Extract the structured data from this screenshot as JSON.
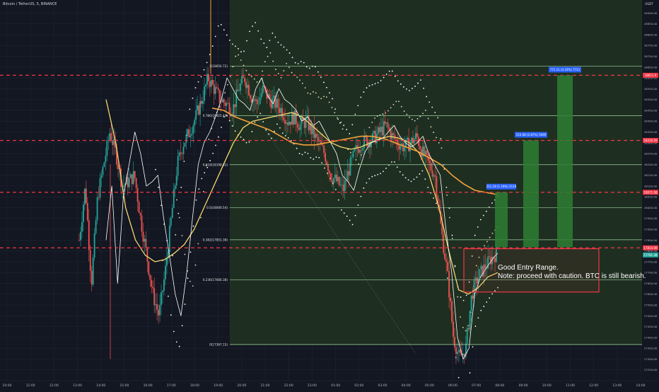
{
  "header": {
    "symbol": "Bitcoin / TetherUS, 5, BINANCE"
  },
  "note": {
    "line1": "Good Entry Range.",
    "line2": "Note: proceed with caution. BTC is still bearish."
  },
  "colors": {
    "background": "#131722",
    "highlight": "#1f3022",
    "grid": "#1e2433",
    "fib_line": "#9fd0a0",
    "red_level": "#f23645",
    "green_bar": "#2e7d32",
    "label_blue": "#2962ff",
    "up_candle": "#26a69a",
    "down_candle": "#ef5350",
    "ma_yellow": "#f5d76e",
    "ma_orange": "#f7a23b",
    "white_line": "#ffffff",
    "dotted_band": "#e8e0b0"
  },
  "chart_data": {
    "type": "candlestick",
    "symbol": "BTCUSDT",
    "timeframe": "5",
    "exchange": "BINANCE",
    "x_ticks": [
      "10:00",
      "11:00",
      "12:00",
      "13:00",
      "14:00",
      "15:00",
      "16:00",
      "17:00",
      "18:00",
      "19:00",
      "20:00",
      "21:00",
      "22:00",
      "23:00",
      "01:00",
      "02:00",
      "03:00",
      "04:00",
      "05:00",
      "06:00",
      "07:00",
      "08:00",
      "09:00",
      "10:00",
      "11:00",
      "12:00",
      "13:00",
      "14:00"
    ],
    "y_ticks": [
      "18900.00",
      "18850.00",
      "18800.00",
      "18750.00",
      "18700.00",
      "18650.00",
      "18600.00",
      "18550.00",
      "18500.00",
      "18450.00",
      "18400.00",
      "18350.00",
      "18300.00",
      "18250.00",
      "18200.00",
      "18150.00",
      "18100.00",
      "18050.00",
      "18000.00",
      "17950.00",
      "17900.00",
      "17850.00",
      "17800.00",
      "17750.00",
      "17700.00",
      "17650.00",
      "17600.00",
      "17550.00",
      "17500.00",
      "17450.00",
      "17400.00",
      "17350.00",
      "17300.00",
      "17250.00"
    ],
    "y_unit_label": "USDT",
    "ylim": [
      17200,
      18960
    ],
    "fib_levels": [
      {
        "ratio": 1,
        "label": "1(18654.72)",
        "price": 18654.72
      },
      {
        "ratio": 0.786,
        "label": "0.786(18425.44)",
        "price": 18425.44
      },
      {
        "ratio": 0.618,
        "label": "0.618(18198.51)",
        "price": 18198.51
      },
      {
        "ratio": 0.5,
        "label": "0.5(18000.54)",
        "price": 18000.54
      },
      {
        "ratio": 0.382,
        "label": "0.382(17851.38)",
        "price": 17851.38
      },
      {
        "ratio": 0.236,
        "label": "0.236(17666.38)",
        "price": 17666.38
      },
      {
        "ratio": 0,
        "label": "0(17367.15)",
        "price": 17367.15
      }
    ],
    "resistance_levels": [
      {
        "label": "18611.9",
        "price": 18611.9
      },
      {
        "label": "18310.59",
        "price": 18310.59
      },
      {
        "label": "18071.08",
        "price": 18071.08
      },
      {
        "label": "17814.09",
        "price": 17814.09
      }
    ],
    "current_price": {
      "label": "17781.38",
      "price": 17781.38
    },
    "targets": [
      {
        "label": "211.19 (1.19%) 2119",
        "top": 18071.08
      },
      {
        "label": "510.08 (2.87%) 5099",
        "top": 18310.59
      },
      {
        "label": "771.11 (4.33%) 7711",
        "top": 18611.9
      }
    ],
    "entry_zone": {
      "low": 17610,
      "high": 17810
    },
    "close_series": [
      17850,
      18100,
      17650,
      18050,
      18200,
      18350,
      18250,
      18100,
      18120,
      18150,
      17950,
      17780,
      17600,
      17500,
      17700,
      17950,
      18200,
      18300,
      18350,
      18420,
      18500,
      18600,
      18550,
      18500,
      18480,
      18450,
      18550,
      18600,
      18520,
      18480,
      18550,
      18500,
      18480,
      18450,
      18400,
      18420,
      18380,
      18400,
      18350,
      18300,
      18250,
      18150,
      18120,
      18080,
      18180,
      18260,
      18300,
      18310,
      18320,
      18350,
      18380,
      18330,
      18300,
      18280,
      18300,
      18330,
      18250,
      18200,
      18150,
      17900,
      17700,
      17400,
      17300,
      17350,
      17600,
      17680,
      17720,
      17760,
      17790
    ],
    "ma_slow": [
      18500,
      18300,
      18000,
      17850,
      17780,
      17750,
      17760,
      17790,
      17830,
      17900,
      18000,
      18100,
      18200,
      18300,
      18370,
      18400,
      18410,
      18420,
      18430,
      18440,
      18420,
      18380,
      18340,
      18300,
      18280,
      18270,
      18280,
      18300,
      18320,
      18330,
      18320,
      18300,
      18250,
      18150,
      18000,
      17800,
      17620,
      17600,
      17630,
      17680,
      17700
    ],
    "ma_fast": [
      18460,
      18450,
      18420,
      18400,
      18380,
      18360,
      18330,
      18300,
      18290,
      18290,
      18300,
      18310,
      18320,
      18330,
      18330,
      18320,
      18300,
      18280,
      18260,
      18230,
      18200,
      18150,
      18110,
      18080,
      18070,
      18060
    ]
  }
}
